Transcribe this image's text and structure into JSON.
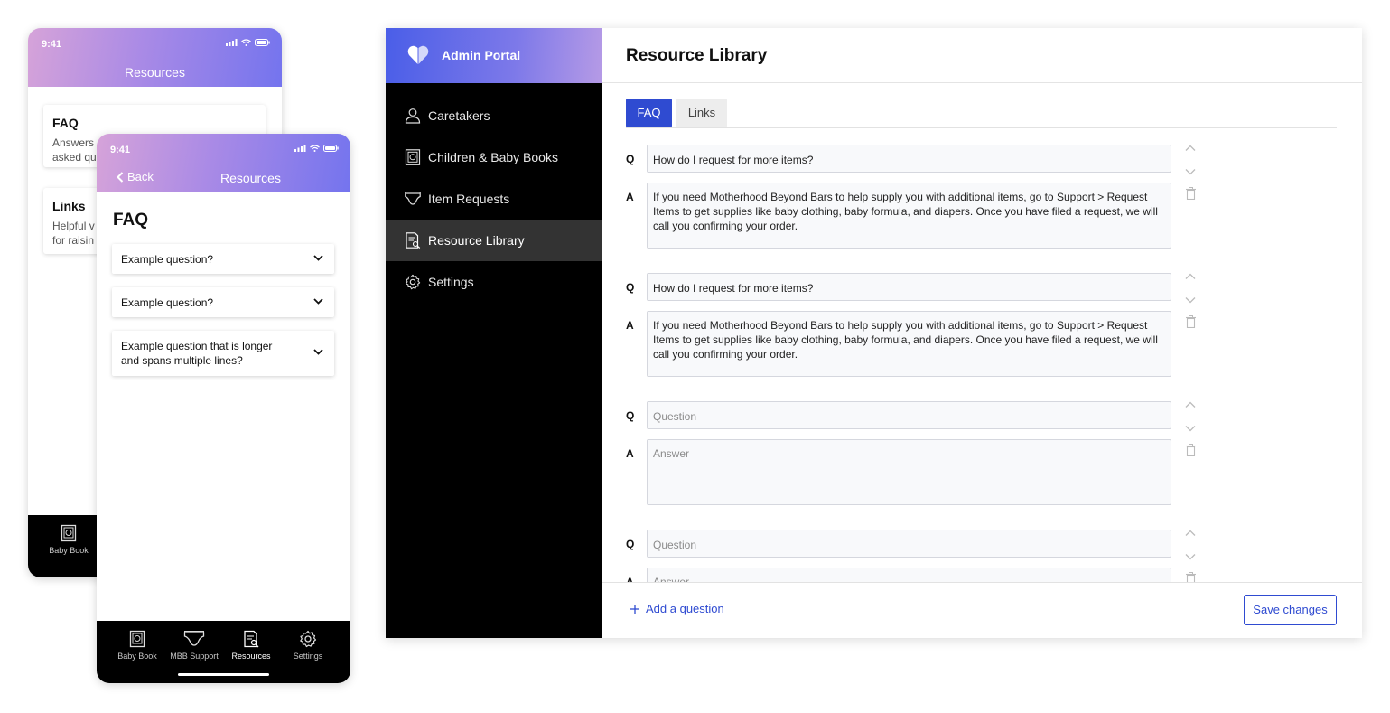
{
  "colors": {
    "accent": "#2f4bd1",
    "sidebar_bg": "#000000",
    "active_nav_bg": "#333333",
    "header_gradient_start": "#4a5ee8",
    "header_gradient_end": "#b59ae6"
  },
  "phone_back": {
    "status_time": "9:41",
    "title": "Resources",
    "cards": [
      {
        "title": "FAQ",
        "desc_line1": "Answers",
        "desc_line2": "asked qu"
      },
      {
        "title": "Links",
        "desc_line1": "Helpful v",
        "desc_line2": "for raisin"
      }
    ],
    "tabbar": [
      {
        "label": "Baby Book",
        "icon": "baby-book-icon"
      }
    ]
  },
  "phone_front": {
    "status_time": "9:41",
    "back_label": "Back",
    "title": "Resources",
    "heading": "FAQ",
    "questions": [
      "Example question?",
      "Example question?",
      "Example question that is longer and spans multiple lines?"
    ],
    "tabbar": [
      {
        "label": "Baby Book",
        "icon": "baby-book-icon"
      },
      {
        "label": "MBB Support",
        "icon": "diaper-icon"
      },
      {
        "label": "Resources",
        "icon": "resources-icon",
        "active": true
      },
      {
        "label": "Settings",
        "icon": "gear-icon"
      }
    ]
  },
  "admin": {
    "brand": "Admin Portal",
    "nav": [
      {
        "label": "Caretakers",
        "icon": "person-icon"
      },
      {
        "label": "Children & Baby Books",
        "icon": "baby-book-icon"
      },
      {
        "label": "Item Requests",
        "icon": "diaper-icon"
      },
      {
        "label": "Resource Library",
        "icon": "resources-icon",
        "active": true
      },
      {
        "label": "Settings",
        "icon": "gear-icon"
      }
    ],
    "page_title": "Resource Library",
    "tabs": [
      {
        "label": "FAQ",
        "active": true
      },
      {
        "label": "Links",
        "active": false
      }
    ],
    "q_label": "Q",
    "a_label": "A",
    "entries": [
      {
        "question": "How do I request for more items?",
        "answer": "If you need Motherhood Beyond Bars to help supply you with additional items, go to Support > Request Items to get supplies like baby clothing, baby formula, and diapers. Once you have filed a request, we will call you confirming your order."
      },
      {
        "question": "How do I request for more items?",
        "answer": "If you need Motherhood Beyond Bars to help supply you with additional items, go to Support > Request Items to get supplies like baby clothing, baby formula, and diapers. Once you have filed a request, we will call you confirming your order."
      },
      {
        "question": "",
        "answer": ""
      },
      {
        "question": "",
        "answer": ""
      }
    ],
    "question_placeholder": "Question",
    "answer_placeholder": "Answer",
    "add_question_label": "Add a question",
    "save_label": "Save changes"
  }
}
